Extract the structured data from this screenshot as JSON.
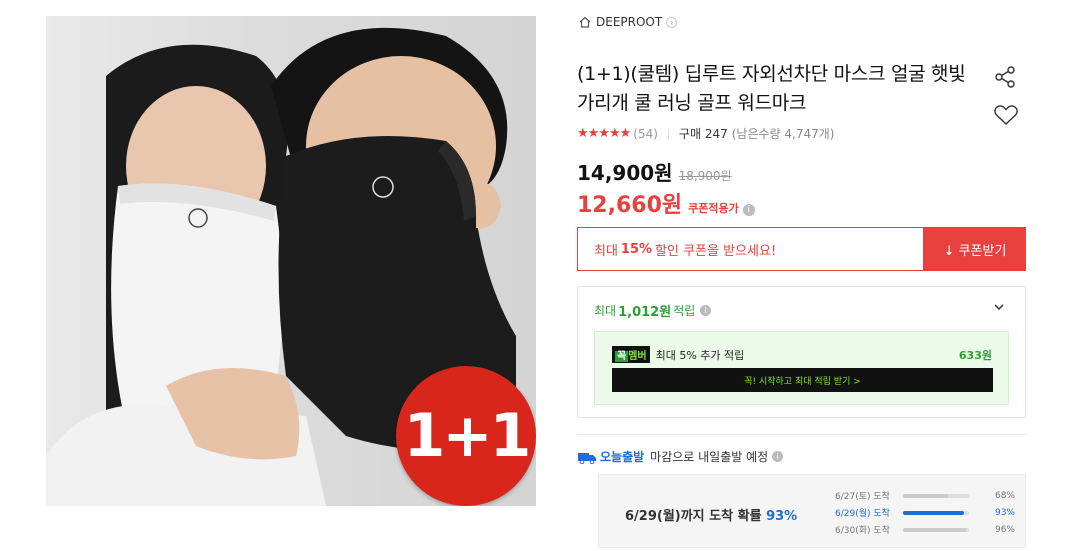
{
  "product": {
    "brand": "DEEPROOT",
    "title": "(1+1)(쿨템) 딥루트 자외선차단 마스크 얼굴 햇빛가리개 쿨 러닝 골프 워드마크",
    "badge_text": "1+1",
    "rating_stars": "★★★★★",
    "rating_value": 4.5,
    "review_count": "(54)",
    "sold_count": "구매 247",
    "stock_text": "(남은수량 4,747개)"
  },
  "price": {
    "sale": "14,900원",
    "original": "18,900원",
    "coupon_price": "12,660원",
    "coupon_label": "쿠폰적용가"
  },
  "coupon": {
    "text_pre": "최대",
    "text_pct": "15%",
    "text_post": "할인 쿠폰을 받으세요!",
    "button_label": "↓ 쿠폰받기"
  },
  "points": {
    "head_pre": "최대",
    "head_amount": "1,012원",
    "head_post": "적립",
    "member_tag_a": "꼭",
    "member_tag_b": "멤버",
    "member_text": "최대 5% 추가 적립",
    "member_amount": "633원",
    "member_cta": "꼭! 시작하고 최대 적립 받기 >"
  },
  "shipping": {
    "badge": "오늘출발",
    "desc": "마감으로 내일출발 예정",
    "eta_text": "6/29(월)까지 도착 확률",
    "eta_pct": "93%",
    "rows": [
      {
        "date": "6/27(토) 도착",
        "pct": "68%",
        "value": 0.68
      },
      {
        "date": "6/29(월) 도착",
        "pct": "93%",
        "value": 0.93
      },
      {
        "date": "6/30(화) 도착",
        "pct": "96%",
        "value": 0.96
      }
    ]
  },
  "colors": {
    "accent_red": "#e8413d",
    "green": "#2aa034",
    "blue": "#1d6fd6"
  }
}
